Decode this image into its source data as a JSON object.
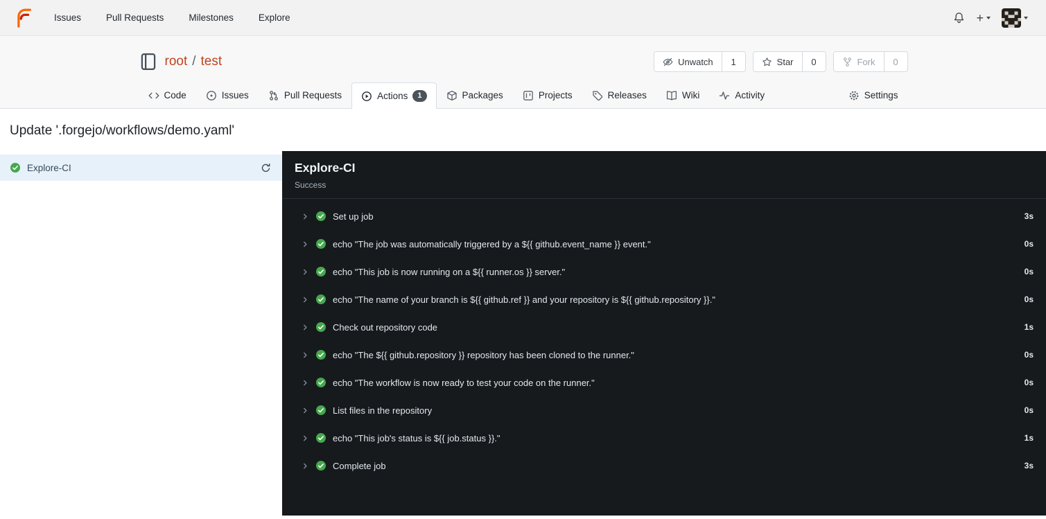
{
  "navbar": {
    "items": [
      {
        "label": "Issues"
      },
      {
        "label": "Pull Requests"
      },
      {
        "label": "Milestones"
      },
      {
        "label": "Explore"
      }
    ],
    "right_icons": [
      {
        "icon": "bell-icon"
      },
      {
        "icon": "plus-icon"
      },
      {
        "icon": "avatar"
      }
    ]
  },
  "repo": {
    "owner": "root",
    "separator": "/",
    "name": "test",
    "header_buttons": [
      {
        "label": "Unwatch",
        "count": "1",
        "icon": "eye-slash-icon"
      },
      {
        "label": "Star",
        "count": "0",
        "icon": "star-icon"
      },
      {
        "label": "Fork",
        "count": "0",
        "icon": "fork-icon"
      }
    ],
    "tabs": [
      {
        "label": "Code",
        "icon": "code-icon"
      },
      {
        "label": "Issues",
        "icon": "issue-icon"
      },
      {
        "label": "Pull Requests",
        "icon": "pull-request-icon"
      },
      {
        "label": "Actions",
        "icon": "play-circle-icon",
        "badge": "1",
        "active": true
      },
      {
        "label": "Packages",
        "icon": "package-icon"
      },
      {
        "label": "Projects",
        "icon": "project-icon"
      },
      {
        "label": "Releases",
        "icon": "tag-icon"
      },
      {
        "label": "Wiki",
        "icon": "book-icon"
      },
      {
        "label": "Activity",
        "icon": "pulse-icon"
      },
      {
        "label": "Settings",
        "icon": "gear-icon"
      }
    ]
  },
  "run": {
    "title": "Update '.forgejo/workflows/demo.yaml'",
    "job_list": [
      {
        "name": "Explore-CI",
        "selected": true,
        "status_icon": "check-circle-icon"
      }
    ],
    "detail": {
      "name": "Explore-CI",
      "status": "Success",
      "steps": [
        {
          "label": "Set up job",
          "duration": "3s"
        },
        {
          "label": "echo \"The job was automatically triggered by a ${{ github.event_name }} event.\"",
          "duration": "0s"
        },
        {
          "label": "echo \"This job is now running on a ${{ runner.os }} server.\"",
          "duration": "0s"
        },
        {
          "label": "echo \"The name of your branch is ${{ github.ref }} and your repository is ${{ github.repository }}.\"",
          "duration": "0s"
        },
        {
          "label": "Check out repository code",
          "duration": "1s"
        },
        {
          "label": "echo \"The ${{ github.repository }} repository has been cloned to the runner.\"",
          "duration": "0s"
        },
        {
          "label": "echo \"The workflow is now ready to test your code on the runner.\"",
          "duration": "0s"
        },
        {
          "label": "List files in the repository",
          "duration": "0s"
        },
        {
          "label": "echo \"This job's status is ${{ job.status }}.\"",
          "duration": "1s"
        },
        {
          "label": "Complete job",
          "duration": "3s"
        }
      ]
    }
  },
  "colors": {
    "brand_orange": "#ff6600",
    "brand_red": "#cc2200",
    "repo_link": "#c2431f",
    "success_green": "#45a84d",
    "panel_dark": "#161a1d",
    "selected_job_bg": "#e7f1fa"
  }
}
